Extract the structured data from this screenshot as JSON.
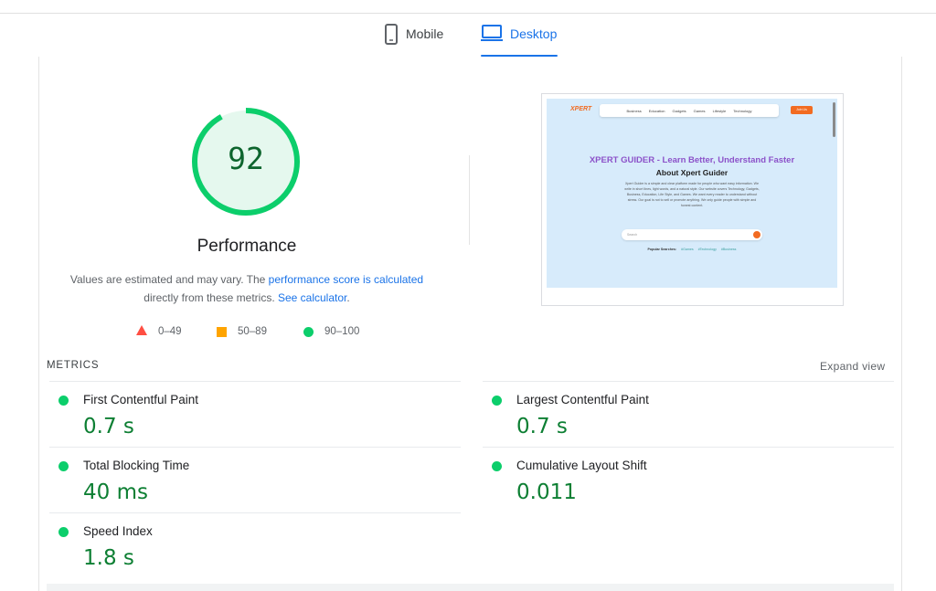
{
  "tabs": {
    "mobile": {
      "label": "Mobile",
      "icon": "phone-icon"
    },
    "desktop": {
      "label": "Desktop",
      "icon": "laptop-icon",
      "active": true
    }
  },
  "performance": {
    "score": "92",
    "score_fraction": 0.92,
    "title": "Performance",
    "desc_prefix": "Values are estimated and may vary. The ",
    "desc_link1": "performance score is calculated",
    "desc_middle": "directly from these metrics. ",
    "desc_link2": "See calculator",
    "desc_suffix": "."
  },
  "legend": {
    "fail": "0–49",
    "average": "50–89",
    "pass": "90–100"
  },
  "screenshot": {
    "logo": "XPERT",
    "nav_items": [
      "Business",
      "Education",
      "Gadgets",
      "Games",
      "Lifestyle",
      "Technology"
    ],
    "cta": "Join Us",
    "headline": "XPERT GUIDER - Learn Better, Understand Faster",
    "subheadline": "About Xpert Guider",
    "paragraph": "Xpert Guider is a simple and clear platform made for people who want easy information. We write in short lines, light words, and a natural style. Our website covers Technology, Gadgets, Business, Education, Life Style, and Games. We want every reader to understand without stress. Our goal is not to sell or promote anything. We only guide people with simple and honest content.",
    "search_placeholder": "Search",
    "popular_label": "Popular Searches:",
    "popular_items": [
      "#Games",
      "#Technology",
      "#Business"
    ]
  },
  "metrics": {
    "label": "METRICS",
    "expand": "Expand view",
    "fcp": {
      "name": "First Contentful Paint",
      "value": "0.7 s"
    },
    "lcp": {
      "name": "Largest Contentful Paint",
      "value": "0.7 s"
    },
    "tbt": {
      "name": "Total Blocking Time",
      "value": "40 ms"
    },
    "cls": {
      "name": "Cumulative Layout Shift",
      "value": "0.011"
    },
    "si": {
      "name": "Speed Index",
      "value": "1.8 s"
    }
  },
  "colors": {
    "pass": "#0cce6b",
    "pass_text": "#0d7f33",
    "average": "#ffa400",
    "fail": "#ff4e42",
    "accent": "#1a73e8"
  }
}
